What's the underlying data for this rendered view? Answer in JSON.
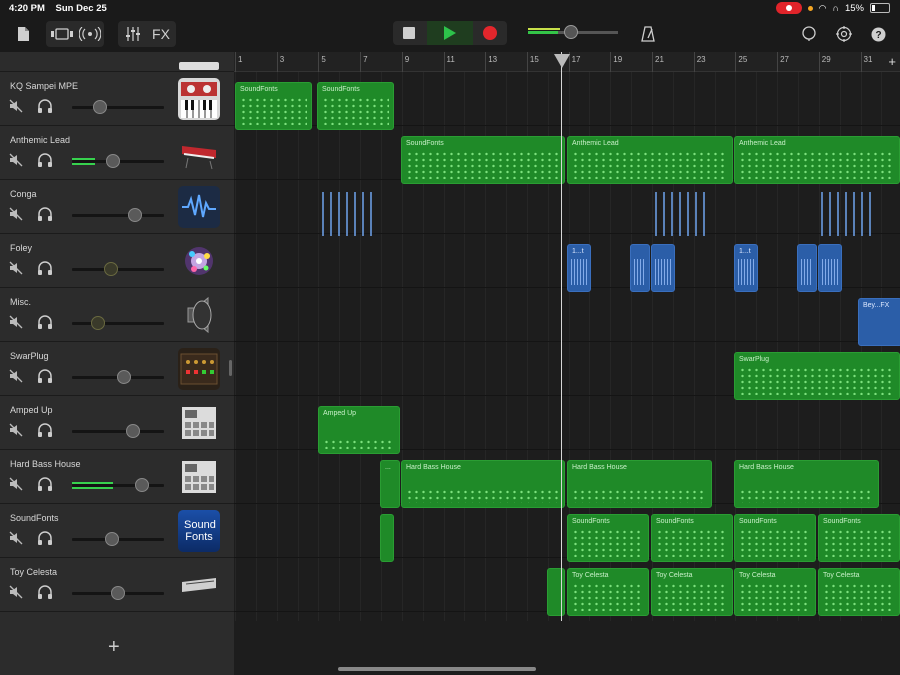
{
  "status": {
    "time": "4:20 PM",
    "date": "Sun Dec 25",
    "battery": "15%"
  },
  "toolbar": {
    "fx_label": "FX",
    "master_volume": 0.48
  },
  "ruler": {
    "bars": [
      "1",
      "3",
      "5",
      "7",
      "9",
      "11",
      "13",
      "15",
      "17",
      "19",
      "21",
      "23",
      "25",
      "27",
      "29",
      "31"
    ],
    "playhead_bar": "17"
  },
  "tracks": [
    {
      "name": "KQ Sampei MPE",
      "volume": 0.3,
      "meter": 0,
      "icon": "synth-keyboard-icon"
    },
    {
      "name": "Anthemic Lead",
      "volume": 0.45,
      "meter": 0.25,
      "icon": "red-keyboard-icon"
    },
    {
      "name": "Conga",
      "volume": 0.68,
      "meter": 0,
      "icon": "waveform-icon"
    },
    {
      "name": "Foley",
      "volume": 0.42,
      "meter": 0,
      "icon": "sparkle-burst-icon"
    },
    {
      "name": "Misc.",
      "volume": 0.28,
      "meter": 0,
      "icon": "speaker-icon"
    },
    {
      "name": "SwarPlug",
      "volume": 0.56,
      "meter": 0,
      "icon": "hardware-unit-icon"
    },
    {
      "name": "Amped Up",
      "volume": 0.66,
      "meter": 0,
      "icon": "drum-machine-icon"
    },
    {
      "name": "Hard Bass House",
      "volume": 0.76,
      "meter": 0.45,
      "icon": "drum-machine-icon"
    },
    {
      "name": "SoundFonts",
      "volume": 0.44,
      "meter": 0,
      "icon": "soundfonts-icon",
      "icon_text": "Sound Fonts"
    },
    {
      "name": "Toy Celesta",
      "volume": 0.5,
      "meter": 0,
      "icon": "keyboard-icon"
    }
  ],
  "regions": {
    "r_sf1": "SoundFonts",
    "r_sf2": "SoundFonts",
    "r_sf3": "SoundFonts",
    "r_al1": "Anthemic Lead",
    "r_al2": "Anthemic Lead",
    "r_f1": "1...t",
    "r_f2": "1...t",
    "r_bey": "Bey...FX",
    "r_swar": "SwarPlug",
    "r_amp": "Amped Up",
    "r_dots": "...",
    "r_hbh1": "Hard Bass House",
    "r_hbh2": "Hard Bass House",
    "r_hbh3": "Hard Bass House",
    "r_sf4": "SoundFonts",
    "r_sf5": "SoundFonts",
    "r_sf6": "SoundFonts",
    "r_sf7": "SoundFonts",
    "r_tc1": "Toy Celesta",
    "r_tc2": "Toy Celesta",
    "r_tc3": "Toy Celesta",
    "r_tc4": "Toy Celesta"
  }
}
